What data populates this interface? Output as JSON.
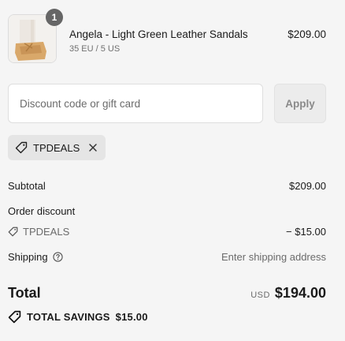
{
  "product": {
    "quantity_badge": "1",
    "name": "Angela - Light Green Leather Sandals",
    "variant": "35 EU / 5 US",
    "price": "$209.00"
  },
  "discount": {
    "placeholder": "Discount code or gift card",
    "apply_label": "Apply",
    "applied_code": "TPDEALS"
  },
  "summary": {
    "subtotal_label": "Subtotal",
    "subtotal_value": "$209.00",
    "order_discount_label": "Order discount",
    "discount_code": "TPDEALS",
    "discount_value": "− $15.00",
    "shipping_label": "Shipping",
    "shipping_value": "Enter shipping address",
    "total_label": "Total",
    "currency": "USD",
    "total_value": "$194.00",
    "savings_label": "TOTAL SAVINGS",
    "savings_value": "$15.00"
  },
  "icons": {
    "tag": "tag-icon",
    "close": "close-icon",
    "help": "help-circle-icon"
  }
}
